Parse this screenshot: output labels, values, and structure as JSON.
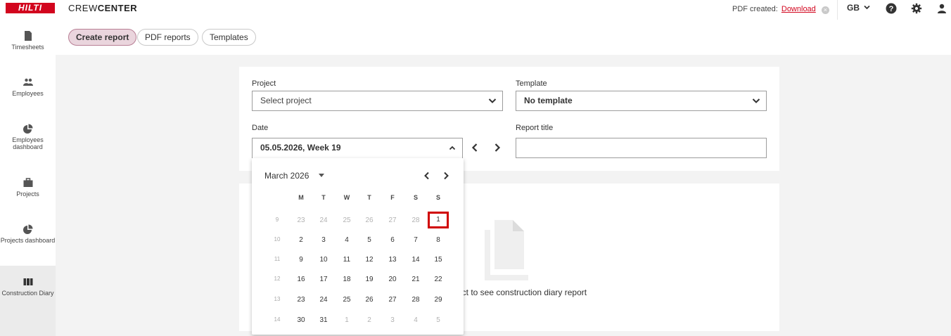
{
  "header": {
    "logo": "HILTI",
    "app_title_light": "CREW",
    "app_title_bold": "CENTER",
    "pdf_label": "PDF created:",
    "pdf_link": "Download",
    "language": "GB",
    "icons": [
      "help-icon",
      "gear-icon",
      "user-icon"
    ]
  },
  "sidebar": {
    "items": [
      {
        "label": "Timesheets",
        "icon": "document-icon"
      },
      {
        "label": "Employees",
        "icon": "people-icon"
      },
      {
        "label": "Employees dashboard",
        "icon": "pie-chart-icon"
      },
      {
        "label": "Projects",
        "icon": "briefcase-icon"
      },
      {
        "label": "Projects dashboard",
        "icon": "pie-chart-icon"
      },
      {
        "label": "Construction Diary",
        "icon": "book-icon"
      }
    ]
  },
  "tabs": [
    {
      "label": "Create report",
      "active": true
    },
    {
      "label": "PDF reports",
      "active": false
    },
    {
      "label": "Templates",
      "active": false
    }
  ],
  "form": {
    "project_label": "Project",
    "project_placeholder": "Select project",
    "template_label": "Template",
    "template_value": "No template",
    "date_label": "Date",
    "date_value": "05.05.2026, Week 19",
    "report_title_label": "Report title",
    "report_title_value": ""
  },
  "empty_state": {
    "text": "ect to see construction diary report"
  },
  "calendar": {
    "month": "March 2026",
    "weekdays": [
      "M",
      "T",
      "W",
      "T",
      "F",
      "S",
      "S"
    ],
    "weeks": [
      {
        "num": "9",
        "days": [
          "23",
          "24",
          "25",
          "26",
          "27",
          "28",
          "1"
        ]
      },
      {
        "num": "10",
        "days": [
          "2",
          "3",
          "4",
          "5",
          "6",
          "7",
          "8"
        ]
      },
      {
        "num": "11",
        "days": [
          "9",
          "10",
          "11",
          "12",
          "13",
          "14",
          "15"
        ]
      },
      {
        "num": "12",
        "days": [
          "16",
          "17",
          "18",
          "19",
          "20",
          "21",
          "22"
        ]
      },
      {
        "num": "13",
        "days": [
          "23",
          "24",
          "25",
          "26",
          "27",
          "28",
          "29"
        ]
      },
      {
        "num": "14",
        "days": [
          "30",
          "31",
          "1",
          "2",
          "3",
          "4",
          "5"
        ]
      }
    ],
    "selected_day": "1",
    "accent_color": "#d00000"
  },
  "colors": {
    "brand": "#d2051e",
    "active_tab_bg": "#ead5dd",
    "content_bg": "#f3f3f3"
  }
}
